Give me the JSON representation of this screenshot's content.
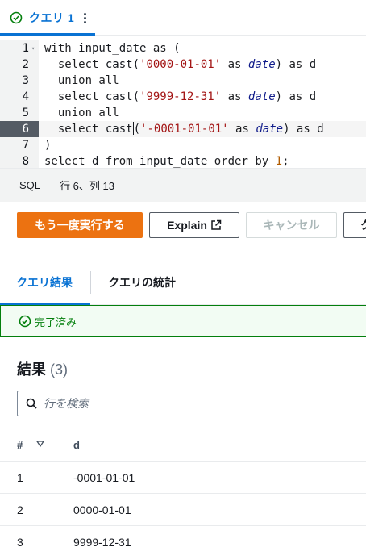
{
  "query_tab": {
    "title": "クエリ 1",
    "status_icon": "check-circle-icon",
    "menu_icon": "kebab-icon"
  },
  "editor": {
    "active_line": 6,
    "lines": [
      {
        "num": "1",
        "fold": "▾",
        "parts": [
          [
            "kw",
            "with"
          ],
          [
            "t",
            " input_date "
          ],
          [
            "kw",
            "as"
          ],
          [
            "t",
            " ("
          ]
        ]
      },
      {
        "num": "2",
        "parts": [
          [
            "t",
            "  "
          ],
          [
            "kw",
            "select"
          ],
          [
            "t",
            " cast("
          ],
          [
            "str",
            "'0000-01-01'"
          ],
          [
            "t",
            " "
          ],
          [
            "kw",
            "as"
          ],
          [
            "t",
            " "
          ],
          [
            "dt",
            "date"
          ],
          [
            "t",
            ") "
          ],
          [
            "kw",
            "as"
          ],
          [
            "t",
            " d"
          ]
        ]
      },
      {
        "num": "3",
        "parts": [
          [
            "t",
            "  "
          ],
          [
            "kw",
            "union all"
          ]
        ]
      },
      {
        "num": "4",
        "parts": [
          [
            "t",
            "  "
          ],
          [
            "kw",
            "select"
          ],
          [
            "t",
            " cast("
          ],
          [
            "str",
            "'9999-12-31'"
          ],
          [
            "t",
            " "
          ],
          [
            "kw",
            "as"
          ],
          [
            "t",
            " "
          ],
          [
            "dt",
            "date"
          ],
          [
            "t",
            ") "
          ],
          [
            "kw",
            "as"
          ],
          [
            "t",
            " d"
          ]
        ]
      },
      {
        "num": "5",
        "parts": [
          [
            "t",
            "  "
          ],
          [
            "kw",
            "union all"
          ]
        ]
      },
      {
        "num": "6",
        "parts": [
          [
            "t",
            "  "
          ],
          [
            "kw",
            "select"
          ],
          [
            "t",
            " cast"
          ],
          [
            "caret",
            ""
          ],
          [
            "t",
            "("
          ],
          [
            "str",
            "'-0001-01-01'"
          ],
          [
            "t",
            " "
          ],
          [
            "kw",
            "as"
          ],
          [
            "t",
            " "
          ],
          [
            "dt",
            "date"
          ],
          [
            "t",
            ") "
          ],
          [
            "kw",
            "as"
          ],
          [
            "t",
            " d"
          ]
        ]
      },
      {
        "num": "7",
        "parts": [
          [
            "t",
            ")"
          ]
        ]
      },
      {
        "num": "8",
        "parts": [
          [
            "kw",
            "select"
          ],
          [
            "t",
            " d "
          ],
          [
            "kw",
            "from"
          ],
          [
            "t",
            " input_date "
          ],
          [
            "kw",
            "order by"
          ],
          [
            "t",
            " "
          ],
          [
            "num",
            "1"
          ],
          [
            "t",
            ";"
          ]
        ]
      }
    ]
  },
  "status_bar": {
    "language": "SQL",
    "position": "行 6、列 13"
  },
  "actions": {
    "run_again": "もう一度実行する",
    "explain": "Explain",
    "explain_icon": "external-link-icon",
    "cancel": "キャンセル",
    "more": "ク"
  },
  "result_tabs": {
    "results": "クエリ結果",
    "stats": "クエリの統計"
  },
  "status_alert": {
    "text": "完了済み",
    "icon": "check-circle-icon"
  },
  "results": {
    "title": "結果",
    "count": "(3)",
    "search_placeholder": "行を検索",
    "columns": [
      "#",
      "d"
    ],
    "rows": [
      [
        "1",
        "-0001-01-01"
      ],
      [
        "2",
        "0000-01-01"
      ],
      [
        "3",
        "9999-12-31"
      ]
    ]
  },
  "colors": {
    "primary_accent": "#0972d3",
    "run_button": "#ec7211",
    "success": "#037f0c"
  }
}
